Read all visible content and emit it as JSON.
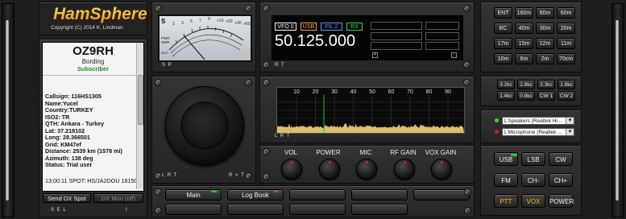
{
  "brand": {
    "name": "HamSphere",
    "copyright": "Copyright (C) 2014 K. Lindman",
    "logo_gradient": [
      "#ffdd55",
      "#ff8800"
    ]
  },
  "profile": {
    "callsign": "OZ9RH",
    "name": "Bording",
    "status": "Subscriber",
    "info_lines": [
      "Callsign: 116HS1305",
      "Name:Yucel",
      "Country:TURKEY",
      "ISO2: TR",
      "QTH: Ankara - Turkey",
      "Lat: 37.218102",
      "Long: 28.366501",
      "Grid: KM47ef",
      "Distance: 2539 km (1578 mi)",
      "Azimuth: 138 deg",
      "Status: Trial user"
    ],
    "spot_line": "13:00:11 SPOT: HS/JA2DOU 18150",
    "buttons": {
      "send_dx": "Send DX Spot",
      "dx_mon": "DX Mon (off)"
    }
  },
  "meter": {
    "scale_top": [
      "1",
      "3",
      "5",
      "7",
      "9",
      "+10",
      "+20",
      "+30",
      "+60"
    ],
    "left_labels": [
      "S",
      "PWR",
      "SWR",
      "ALC"
    ]
  },
  "vfo": {
    "tabs": [
      "VFO 0",
      "USB",
      "FIL 2",
      "RX"
    ],
    "frequency": "50.125.000",
    "active_color": "#ffffff",
    "usb_color": "#ffa040",
    "fil_color": "#60a0ff",
    "rx_color": "#40e040"
  },
  "spectrum": {
    "ticks": [
      "10",
      "20",
      "30",
      "40",
      "50",
      "60",
      "70",
      "80",
      "90"
    ],
    "marker_color": "#20c020",
    "noise_color": "#d8c070"
  },
  "bands": [
    "ENT",
    "160m",
    "80m",
    "60m",
    "BC",
    "40m",
    "30m",
    "20m",
    "17m",
    "15m",
    "12m",
    "11m",
    "10m",
    "6m",
    "2m",
    "70cm"
  ],
  "filters": [
    "3.2kc",
    "2.8kc",
    "2.3kc",
    "1.8kc",
    "1.4kc",
    "0.8kc",
    "CW 1",
    "CW 2"
  ],
  "audio": {
    "speaker": "1:Speakers (Realtek Hi...",
    "mic": "1:Microphone (Realtek ..."
  },
  "knobs": [
    "VOL",
    "POWER",
    "MIC",
    "RF GAIN",
    "VOX GAIN"
  ],
  "modes": [
    "USB",
    "LSB",
    "CW",
    "FM",
    "CH-",
    "CH+",
    "PTT",
    "VOX",
    "POWER"
  ],
  "mode_colors": {
    "on": "#20d020",
    "red": "#e03020",
    "accent": "#ffaa20"
  },
  "bottom_buttons": [
    "Main",
    "Log Book",
    "",
    "",
    "",
    "",
    "",
    "",
    ""
  ],
  "tags": {
    "sp": "S P",
    "rt1": "R T",
    "rt2": "R T",
    "lrt": "L R T",
    "r_t": "R = T",
    "ll": "L L",
    "sel": "S E L",
    "lrt2": "L R T",
    "side_i": "I"
  }
}
